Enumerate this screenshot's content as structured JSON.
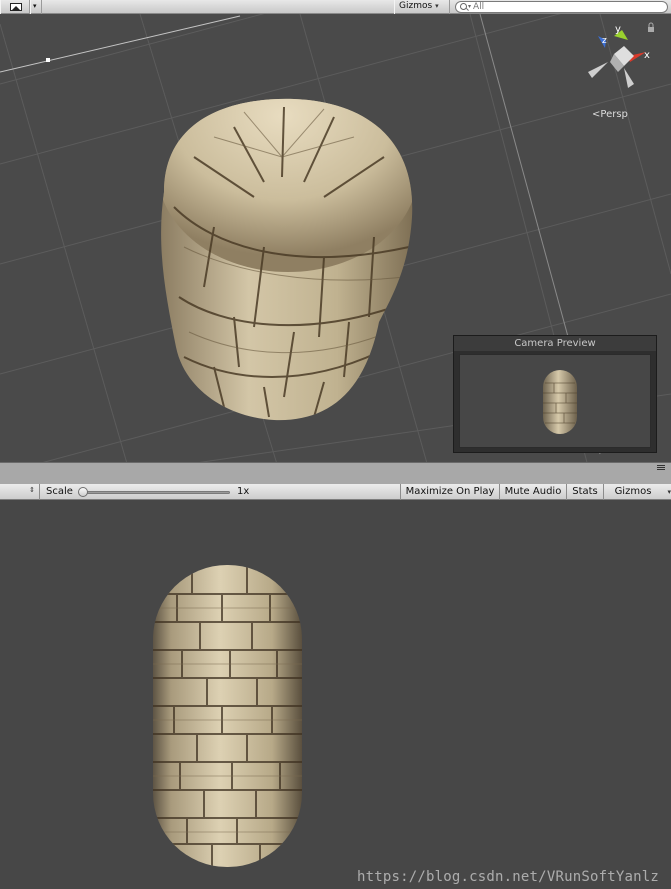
{
  "scene_toolbar": {
    "gizmos_label": "Gizmos",
    "search_placeholder": "All"
  },
  "orientation_gizmo": {
    "axis_y": "y",
    "axis_x": "x",
    "axis_z": "z",
    "projection_label": "Persp"
  },
  "camera_preview": {
    "title": "Camera Preview"
  },
  "game_toolbar": {
    "scale_label": "Scale",
    "scale_value": "1x",
    "scale_fraction": 0.0,
    "maximize_label": "Maximize On Play",
    "mute_label": "Mute Audio",
    "stats_label": "Stats",
    "gizmos_label": "Gizmos"
  },
  "watermark": "https://blog.csdn.net/VRunSoftYanlz",
  "colors": {
    "scene_background": "#4a4a4a",
    "game_background": "#474747",
    "toolbar": "#d6d6d6",
    "stone": "#c9bb9c"
  },
  "icons": [
    "image-icon",
    "search-icon",
    "orientation-gizmo-icon",
    "pane-menu-icon",
    "lock-icon"
  ]
}
